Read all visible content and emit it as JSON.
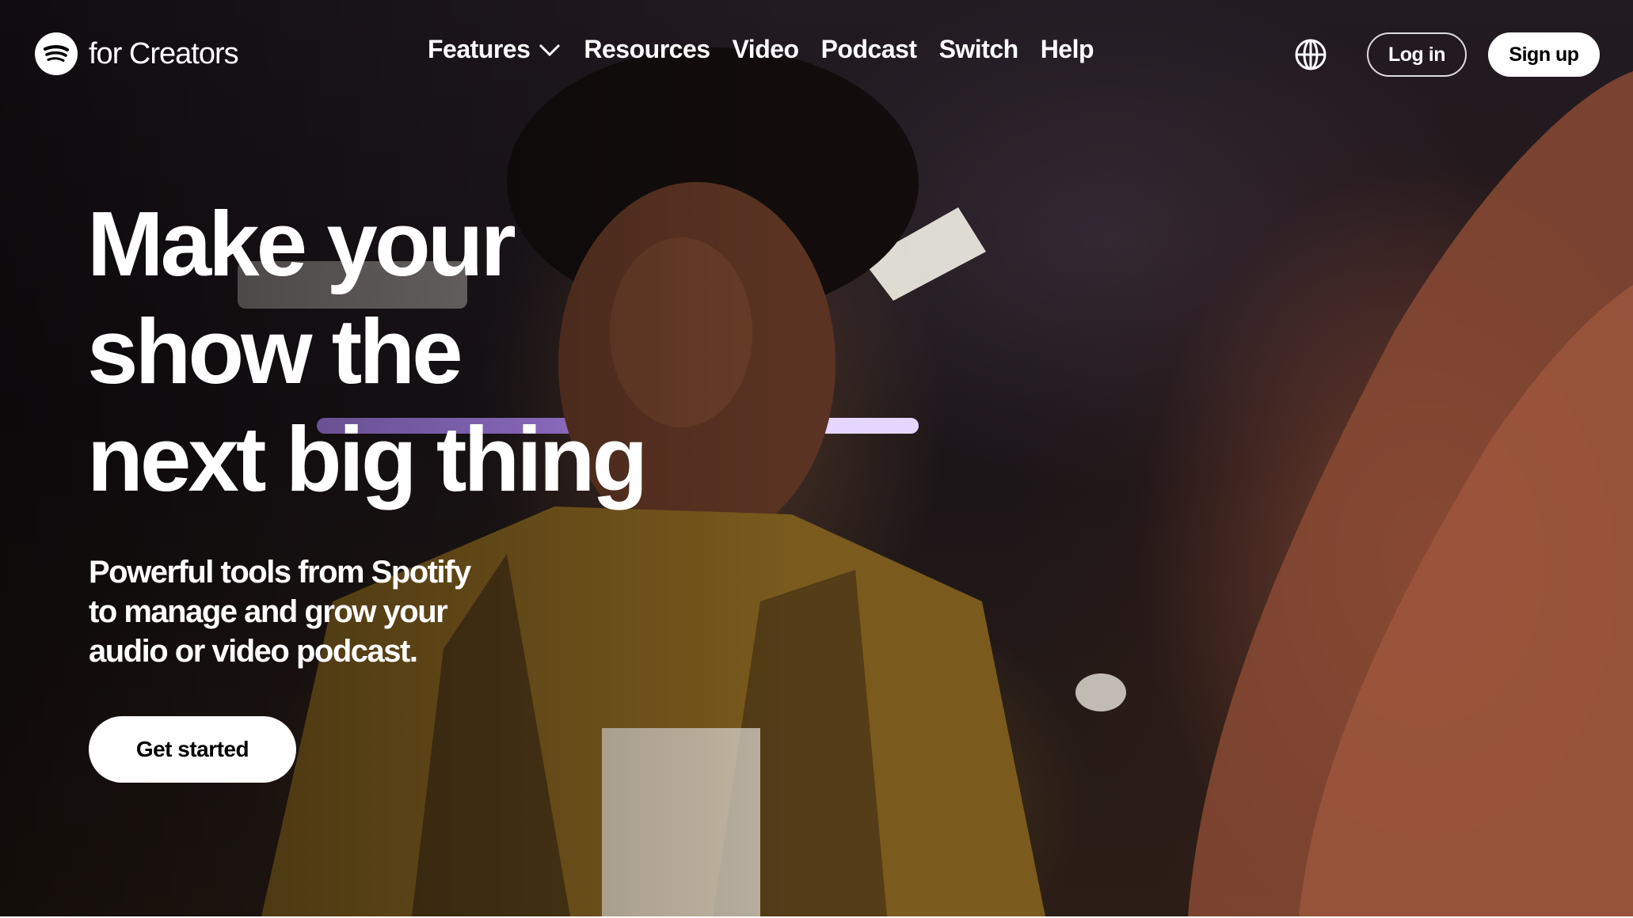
{
  "brand": {
    "logo_icon": "spotify-icon",
    "name": "for Creators"
  },
  "nav": {
    "items": [
      {
        "label": "Features",
        "icon": "chevron-down-icon"
      },
      {
        "label": "Resources"
      },
      {
        "label": "Video"
      },
      {
        "label": "Podcast"
      },
      {
        "label": "Switch"
      },
      {
        "label": "Help"
      }
    ]
  },
  "header_actions": {
    "language_icon": "globe-icon",
    "login_label": "Log in",
    "signup_label": "Sign up"
  },
  "hero": {
    "headline_lines": [
      "Make your",
      "show the",
      "next big thing"
    ],
    "subhead_lines": [
      "Powerful tools from Spotify",
      "to manage and grow your",
      "audio or video podcast."
    ],
    "cta_label": "Get started"
  },
  "colors": {
    "text": "#ffffff",
    "button_bg": "#ffffff",
    "button_text": "#000000",
    "accent_purple": "#b68cff"
  }
}
